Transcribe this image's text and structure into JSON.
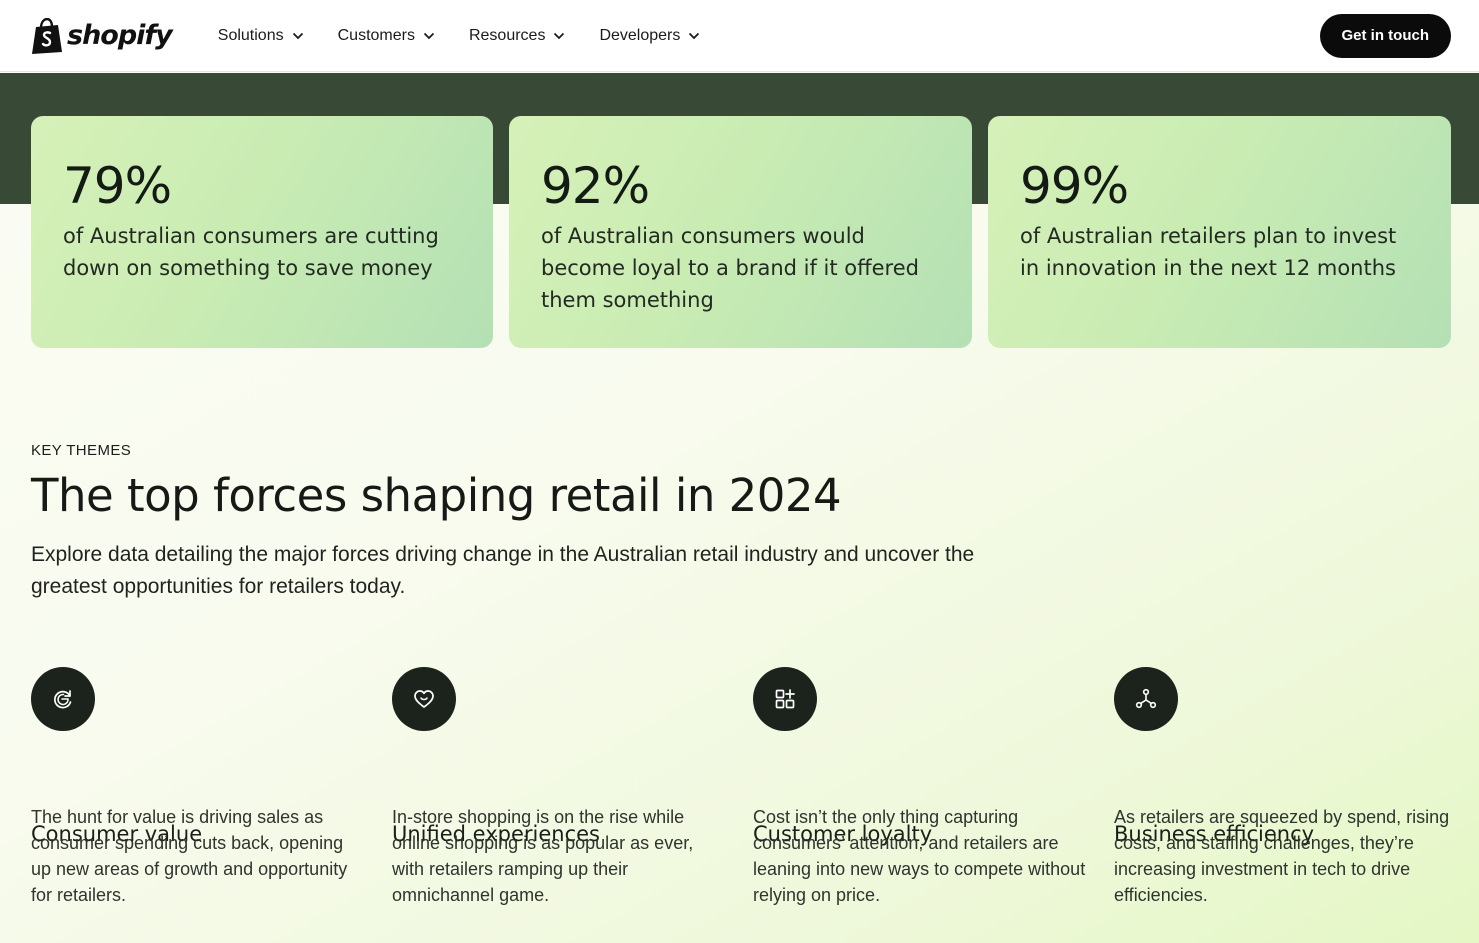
{
  "header": {
    "brand": "shopify",
    "nav": [
      {
        "label": "Solutions"
      },
      {
        "label": "Customers"
      },
      {
        "label": "Resources"
      },
      {
        "label": "Developers"
      }
    ],
    "cta_label": "Get in touch"
  },
  "stats": [
    {
      "value": "79%",
      "text": "of Australian consumers are cutting down on something to save money"
    },
    {
      "value": "92%",
      "text": "of Australian consumers would become loyal to a brand if it offered them something"
    },
    {
      "value": "99%",
      "text": "of Australian retailers plan to invest in innovation in the next 12 months"
    }
  ],
  "key_themes": {
    "eyebrow": "KEY THEMES",
    "title": "The top forces shaping retail in 2024",
    "subtitle": "Explore data detailing the major forces driving change in the Australian retail industry and uncover the greatest opportunities for retailers today.",
    "features": [
      {
        "icon": "refresh-value-icon",
        "title": "Consumer value",
        "body": "The hunt for value is driving sales as consumer spending cuts back, opening up new areas of growth and opportunity for retailers."
      },
      {
        "icon": "heart-icon",
        "title": "Unified experiences",
        "body": "In-store shopping is on the rise while online shopping is as popular as ever, with retailers ramping up their omnichannel game."
      },
      {
        "icon": "apps-add-icon",
        "title": "Customer loyalty",
        "body": "Cost isn’t the only thing capturing consumers’ attention, and retailers are leaning into new ways to compete without relying on price."
      },
      {
        "icon": "network-icon",
        "title": "Business efficiency",
        "body": "As retailers are squeezed by spend, rising costs, and staffing challenges, they’re increasing investment in tech to drive efficiencies."
      }
    ]
  },
  "colors": {
    "header_bg": "#ffffff",
    "band_bg": "#384a36",
    "card_gradient_start": "#d6f1b8",
    "card_gradient_end": "#b4e0b4",
    "icon_circle": "#1b231c",
    "cta_bg": "#0b0b0b"
  }
}
